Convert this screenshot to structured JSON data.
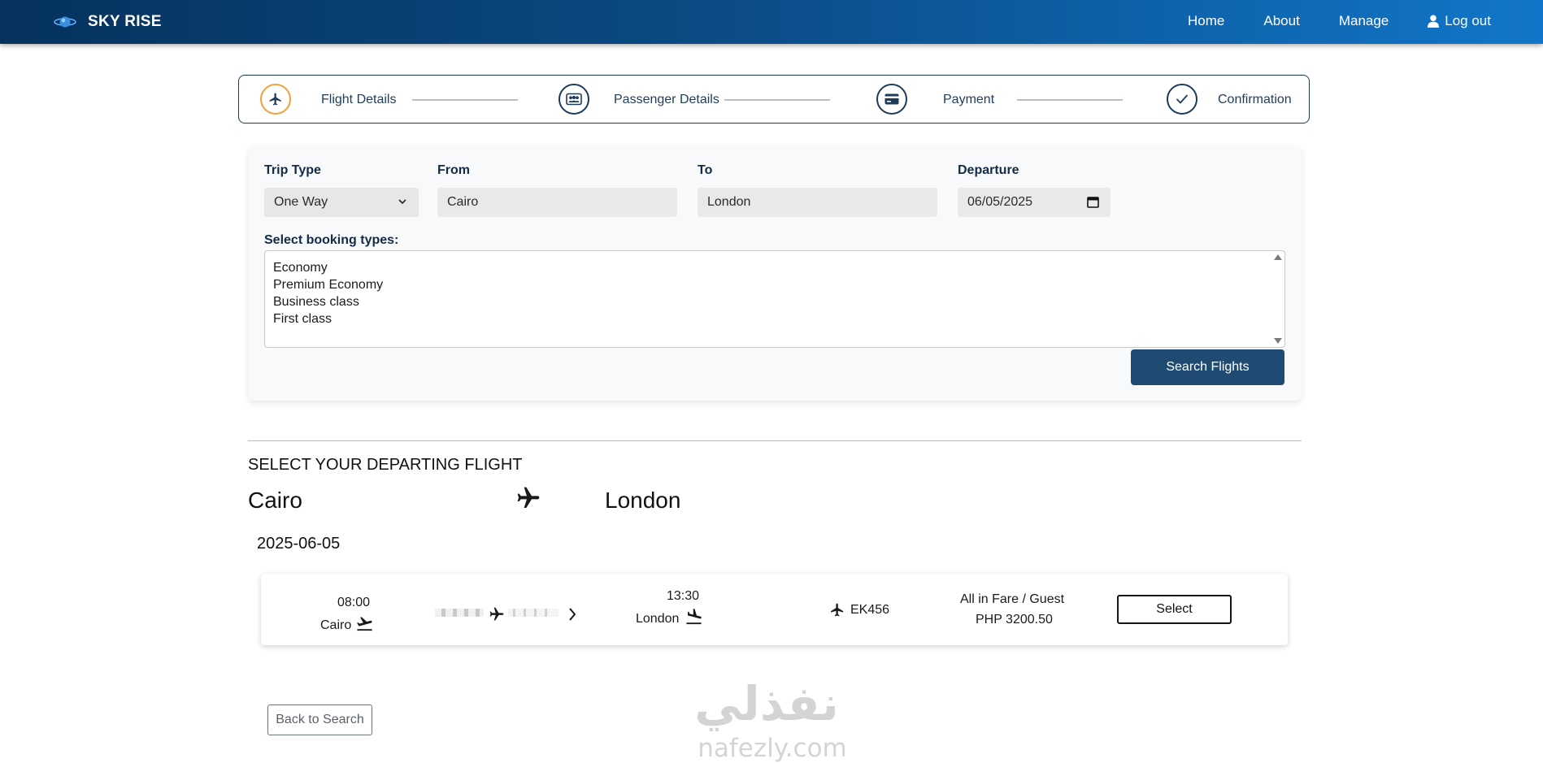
{
  "nav": {
    "brand": "SKY RISE",
    "links": {
      "home": "Home",
      "about": "About",
      "manage": "Manage",
      "logout": "Log out"
    }
  },
  "stepper": {
    "steps": [
      {
        "label": "Flight Details",
        "icon": "plane-icon",
        "active": true
      },
      {
        "label": "Passenger Details",
        "icon": "users-icon",
        "active": false
      },
      {
        "label": "Payment",
        "icon": "credit-card-icon",
        "active": false
      },
      {
        "label": "Confirmation",
        "icon": "check-icon",
        "active": false
      }
    ],
    "active_color": "#f0a13c"
  },
  "search": {
    "trip_type": {
      "label": "Trip Type",
      "value": "One Way"
    },
    "from": {
      "label": "From",
      "value": "Cairo"
    },
    "to": {
      "label": "To",
      "value": "London"
    },
    "departure": {
      "label": "Departure",
      "value": "06/05/2025"
    },
    "booking_types": {
      "label": "Select booking types:",
      "options": [
        "Economy",
        "Premium Economy",
        "Business class",
        "First class"
      ]
    },
    "search_button": "Search Flights"
  },
  "results": {
    "heading": "SELECT YOUR DEPARTING FLIGHT",
    "origin": "Cairo",
    "destination": "London",
    "date": "2025-06-05",
    "flights": [
      {
        "depart_time": "08:00",
        "depart_city": "Cairo",
        "arrive_time": "13:30",
        "arrive_city": "London",
        "flight_number": "EK456",
        "fare_label": "All in Fare / Guest",
        "fare": "PHP 3200.50",
        "select_label": "Select"
      }
    ],
    "back_button": "Back to Search"
  },
  "watermark": {
    "arabic": "نفذلي",
    "latin": "nafezly.com"
  },
  "colors": {
    "navbar_start": "#06325d",
    "navbar_end": "#1176c9",
    "primary": "#1f4b72",
    "accent": "#f0a13c"
  }
}
